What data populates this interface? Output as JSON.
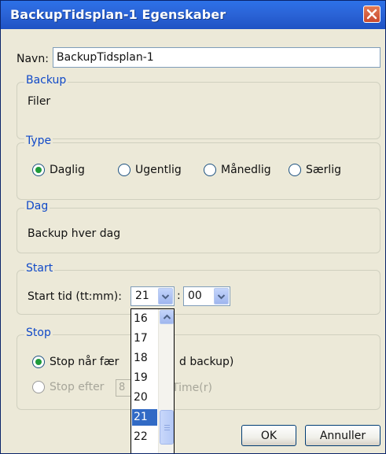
{
  "window": {
    "title": "BackupTidsplan-1 Egenskaber"
  },
  "name": {
    "label": "Navn:",
    "value": "BackupTidsplan-1"
  },
  "backup": {
    "title": "Backup",
    "value": "Filer"
  },
  "type": {
    "title": "Type",
    "options": [
      {
        "label": "Daglig",
        "checked": true
      },
      {
        "label": "Ugentlig",
        "checked": false
      },
      {
        "label": "Månedlig",
        "checked": false
      },
      {
        "label": "Særlig",
        "checked": false
      }
    ]
  },
  "dag": {
    "title": "Dag",
    "value": "Backup hver dag"
  },
  "start": {
    "title": "Start",
    "label": "Start tid (tt:mm):",
    "hour": "21",
    "separator": ":",
    "minute": "00"
  },
  "hour_dropdown": {
    "items": [
      "16",
      "17",
      "18",
      "19",
      "20",
      "21",
      "22"
    ],
    "selected": "21"
  },
  "stop": {
    "title": "Stop",
    "option1_start": "Stop når fær",
    "option1_end": "d backup)",
    "option2_start": "Stop efter",
    "option2_value": "8",
    "option2_end": "Time(r)"
  },
  "buttons": {
    "ok": "OK",
    "cancel": "Annuller"
  },
  "colors": {
    "titlebar": "#2B64D7",
    "dialog_bg": "#ECE9D8",
    "group_title": "#1049C8",
    "selection": "#316AC5",
    "radio_dot": "#1F9B3A"
  }
}
